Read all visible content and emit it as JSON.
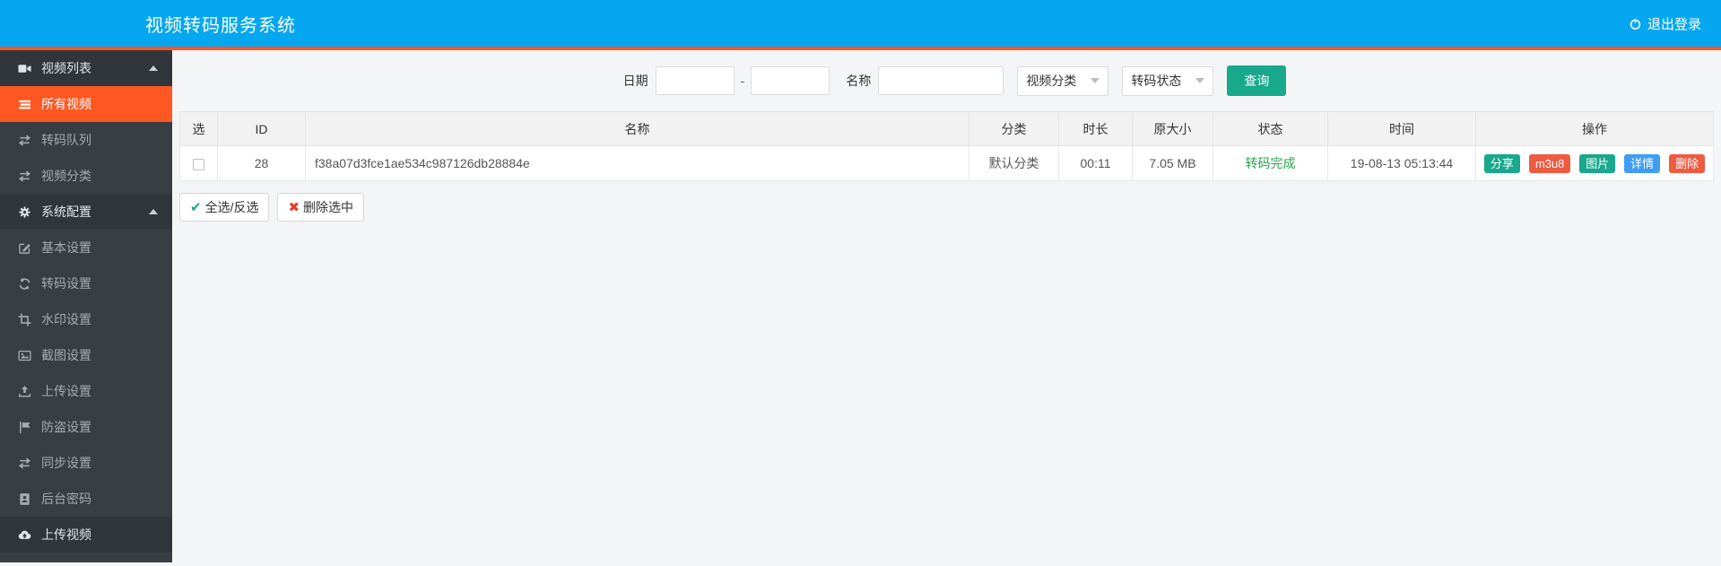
{
  "header": {
    "title": "视频转码服务系统",
    "logout_label": "退出登录",
    "logout_icon": "power-icon"
  },
  "sidebar": {
    "items": [
      {
        "label": "视频列表",
        "icon": "videocam-icon",
        "type": "section",
        "caret": "up"
      },
      {
        "label": "所有视频",
        "icon": "list-icon",
        "type": "item",
        "active": true
      },
      {
        "label": "转码队列",
        "icon": "exchange-icon",
        "type": "item"
      },
      {
        "label": "视频分类",
        "icon": "exchange-icon",
        "type": "item"
      },
      {
        "label": "系统配置",
        "icon": "gear-icon",
        "type": "section",
        "caret": "up"
      },
      {
        "label": "基本设置",
        "icon": "edit-icon",
        "type": "item"
      },
      {
        "label": "转码设置",
        "icon": "refresh-icon",
        "type": "item"
      },
      {
        "label": "水印设置",
        "icon": "crop-icon",
        "type": "item"
      },
      {
        "label": "截图设置",
        "icon": "image-icon",
        "type": "item"
      },
      {
        "label": "上传设置",
        "icon": "upload-icon",
        "type": "item"
      },
      {
        "label": "防盗设置",
        "icon": "flag-icon",
        "type": "item"
      },
      {
        "label": "同步设置",
        "icon": "exchange-icon",
        "type": "item"
      },
      {
        "label": "后台密码",
        "icon": "id-card-icon",
        "type": "item"
      },
      {
        "label": "上传视频",
        "icon": "cloud-upload-icon",
        "type": "section"
      }
    ]
  },
  "filter": {
    "date_label": "日期",
    "date_from": "",
    "separator": "-",
    "date_to": "",
    "name_label": "名称",
    "name_value": "",
    "category_select": "视频分类",
    "status_select": "转码状态",
    "query_button": "查询"
  },
  "table": {
    "columns": [
      "选",
      "ID",
      "名称",
      "分类",
      "时长",
      "原大小",
      "状态",
      "时间",
      "操作"
    ],
    "rows": [
      {
        "selected": false,
        "id": "28",
        "name": "f38a07d3fce1ae534c987126db28884e",
        "category": "默认分类",
        "duration": "00:11",
        "size": "7.05 MB",
        "status": "转码完成",
        "time": "19-08-13 05:13:44",
        "actions": [
          "分享",
          "m3u8",
          "图片",
          "详情",
          "删除"
        ]
      }
    ]
  },
  "bulk": {
    "check_icon": "✔",
    "select_all_label": "全选/反选",
    "x_icon": "✖",
    "delete_selected_label": "删除选中"
  },
  "colors": {
    "header_bg": "#04a7f0",
    "accent_orange": "#ff5722",
    "sidebar_bg": "#383e44",
    "sidebar_section_bg": "#30363c",
    "teal": "#18a88c",
    "red": "#ee5b41",
    "blue": "#3f9ef2",
    "status_green": "#2aa34f"
  }
}
